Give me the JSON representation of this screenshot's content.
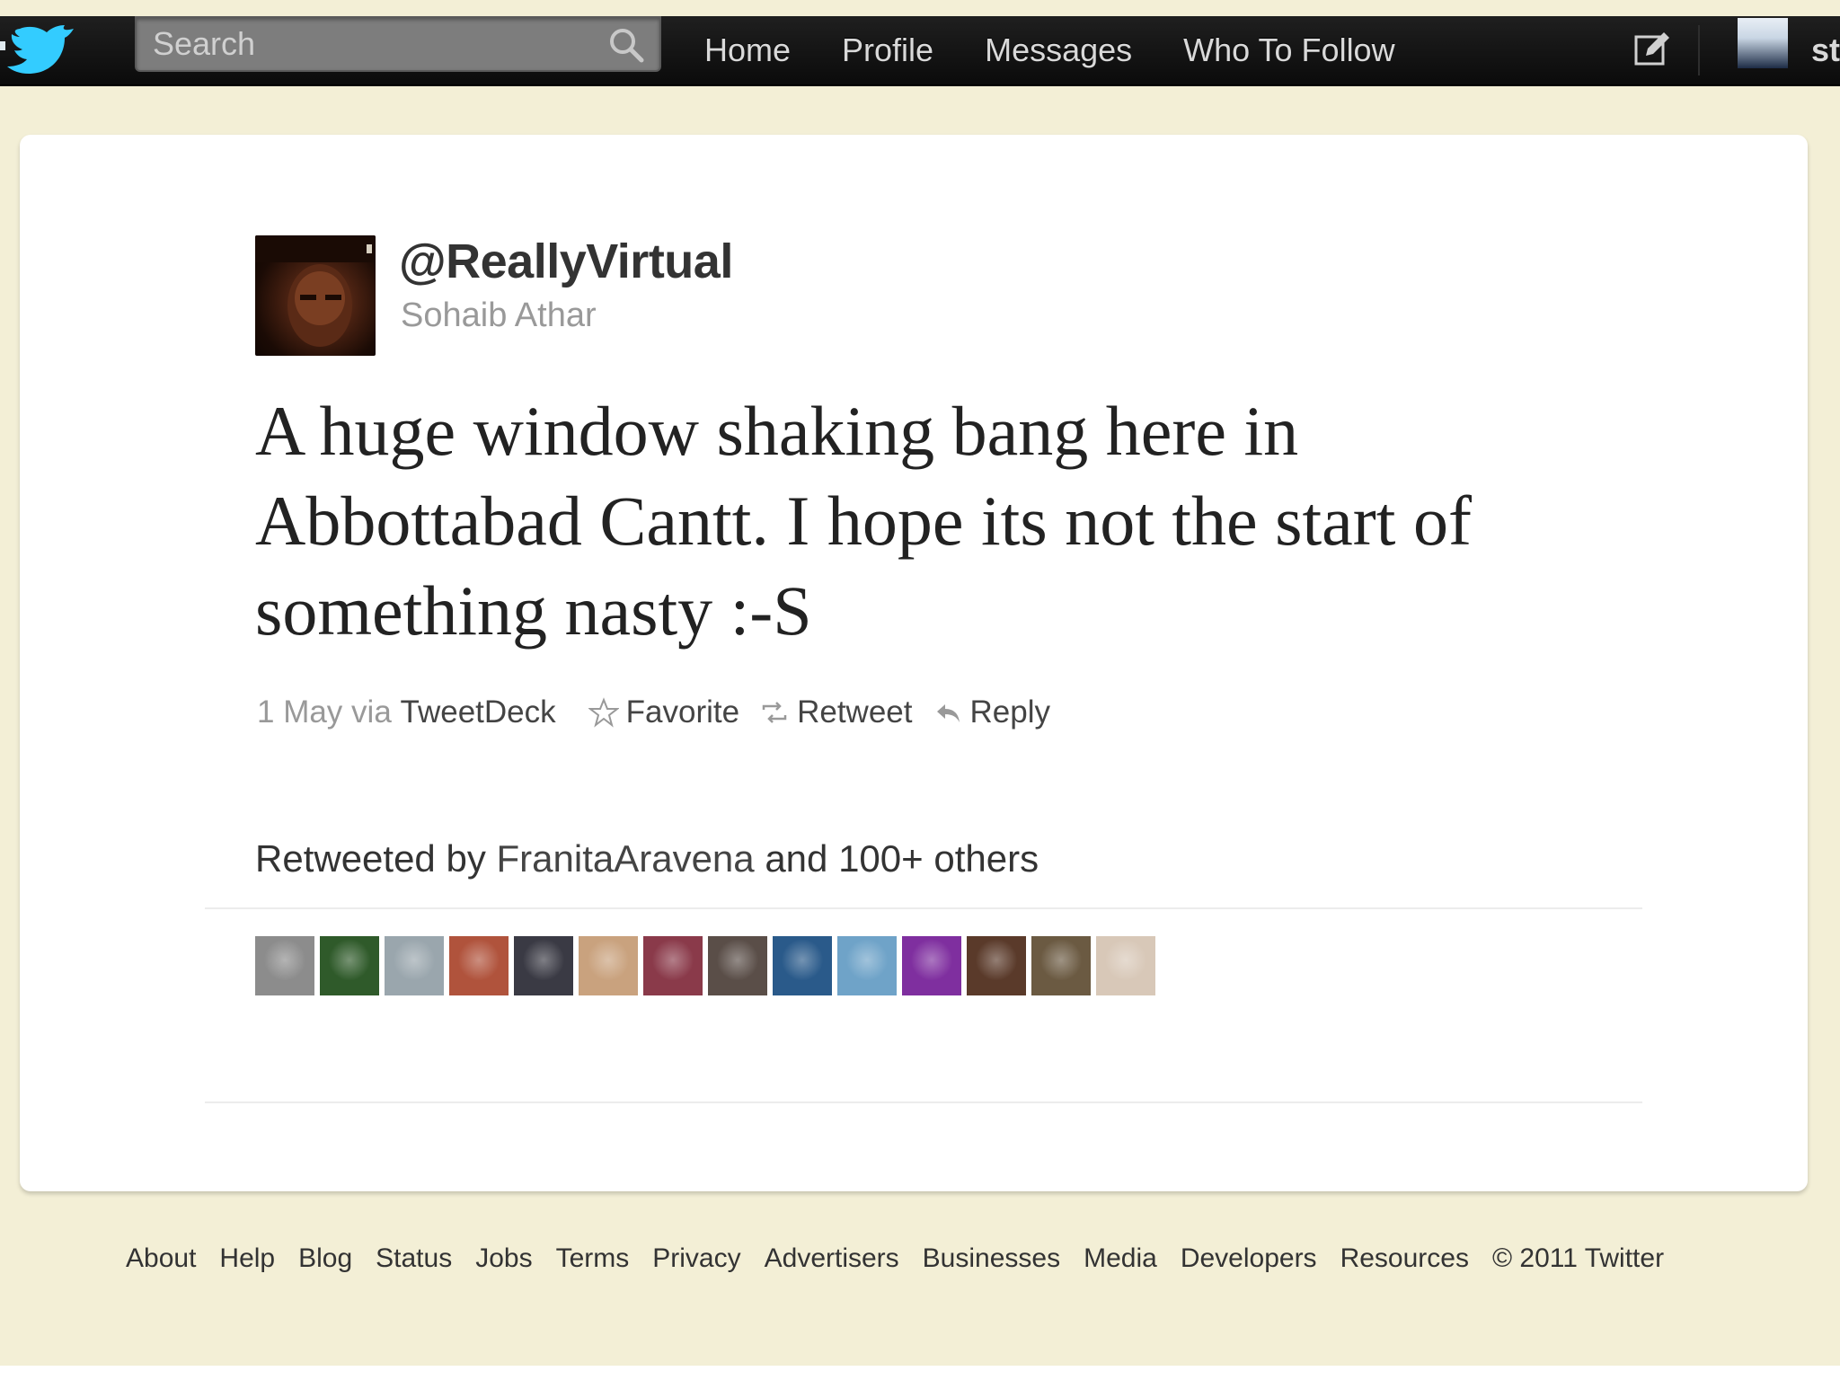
{
  "topbar": {
    "search_placeholder": "Search",
    "nav": [
      "Home",
      "Profile",
      "Messages",
      "Who To Follow"
    ],
    "user_truncated": "st"
  },
  "tweet": {
    "handle": "@ReallyVirtual",
    "name": "Sohaib Athar",
    "text": "A huge window shaking bang here in Abbottabad Cantt. I hope its not the start of something nasty :-S",
    "date": "1 May",
    "via": "via",
    "source": "TweetDeck",
    "actions": {
      "favorite": "Favorite",
      "retweet": "Retweet",
      "reply": "Reply"
    },
    "retweeted_prefix": "Retweeted by",
    "retweeter": "FranitaAravena",
    "retweeted_suffix": "and 100+ others"
  },
  "retweeter_avatar_colors": [
    "#8c8c8c",
    "#2f5a2a",
    "#9aa6ad",
    "#b0533c",
    "#3a3a44",
    "#c9a27e",
    "#8a3a4a",
    "#5a4e48",
    "#2a5a8a",
    "#6fa3c8",
    "#7f2f9f",
    "#5a3a2a",
    "#6b5a42",
    "#d8c8b8"
  ],
  "footer": {
    "links": [
      "About",
      "Help",
      "Blog",
      "Status",
      "Jobs",
      "Terms",
      "Privacy",
      "Advertisers",
      "Businesses",
      "Media",
      "Developers",
      "Resources"
    ],
    "copyright": "© 2011 Twitter"
  },
  "colors": {
    "page_background": "#f3efd6",
    "topbar": "#111111",
    "twitter_blue": "#33ccff"
  }
}
